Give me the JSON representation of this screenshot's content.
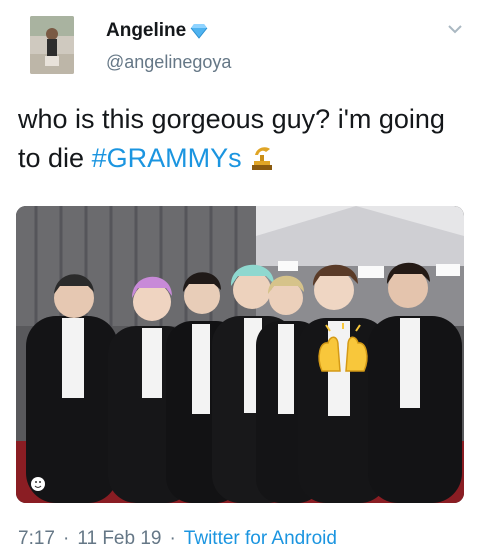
{
  "user": {
    "display_name": "Angeline",
    "handle": "@angelinegoya",
    "verified_icon": "verified-diamond-icon"
  },
  "tweet": {
    "text_lead": "who is this gorgeous guy? i'm going to die ",
    "hashtag": "#GRAMMYs",
    "trailing_icon": "gramophone-trophy-icon"
  },
  "photo": {
    "description_icon": "photo"
  },
  "meta": {
    "time": "7:17",
    "sep1": "·",
    "date": "11 Feb 19",
    "sep2": "·",
    "source": "Twitter for Android"
  },
  "colors": {
    "link": "#1b95e0",
    "muted": "#657786",
    "text": "#14171a"
  }
}
